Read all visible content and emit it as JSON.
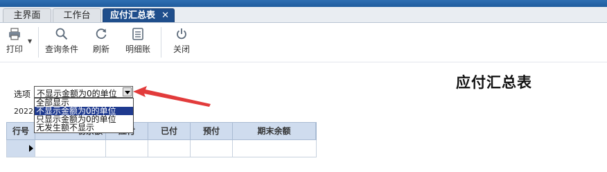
{
  "tabs": [
    {
      "label": "主界面"
    },
    {
      "label": "工作台"
    },
    {
      "label": "应付汇总表",
      "active": true,
      "close": "✕"
    }
  ],
  "toolbar": {
    "print_label": "打印",
    "query_label": "查询条件",
    "refresh_label": "刷新",
    "detail_label": "明细账",
    "close_label": "关闭"
  },
  "report": {
    "title": "应付汇总表"
  },
  "filter": {
    "label": "选项",
    "selected": "不显示金额为0的单位",
    "date_text": "2022-",
    "options": [
      "全部显示",
      "不显示金额为0的单位",
      "只显示金额为0的单位",
      "无发生额不显示"
    ],
    "selected_index": 1
  },
  "grid": {
    "columns": [
      "行号",
      "初余额",
      "应付",
      "已付",
      "预付",
      "期末余额"
    ]
  },
  "colors": {
    "active_tab": "#1f4e8c",
    "grid_header": "#cfdcee",
    "selection": "#1f3a8f",
    "annotation_arrow": "#e23b3b"
  }
}
